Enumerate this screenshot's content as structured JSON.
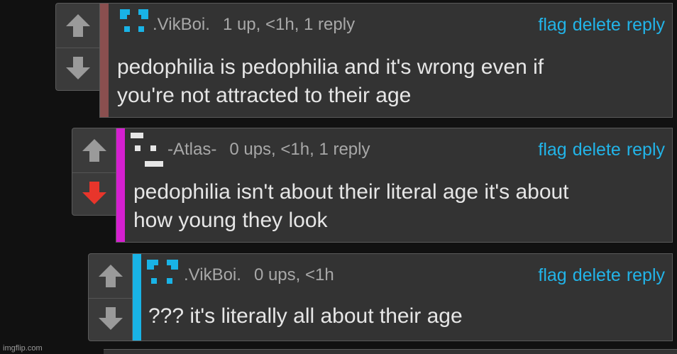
{
  "colors": {
    "background": "#111111",
    "card": "#333333",
    "link": "#22b4e8",
    "downvoted": "#e8352b",
    "arrow": "#9a9a9a",
    "stripe_1": "#8a4f4f",
    "stripe_2": "#d51fd0",
    "stripe_3": "#19b3e6"
  },
  "comments": [
    {
      "username": ".VikBoi.",
      "meta": "1 up, <1h, 1 reply",
      "actions": {
        "flag": "flag",
        "delete": "delete",
        "reply": "reply"
      },
      "text": "pedophilia is pedophilia and it's wrong even if\nyou're not attracted to their age",
      "upvote_icon": "up-arrow-icon",
      "downvote_icon": "down-arrow-icon",
      "downvoted": false
    },
    {
      "username": "-Atlas-",
      "meta": "0 ups, <1h, 1 reply",
      "actions": {
        "flag": "flag",
        "delete": "delete",
        "reply": "reply"
      },
      "text": "pedophilia isn't about their literal age it's about\nhow young they look",
      "upvote_icon": "up-arrow-icon",
      "downvote_icon": "down-arrow-icon",
      "downvoted": true
    },
    {
      "username": ".VikBoi.",
      "meta": "0 ups, <1h",
      "actions": {
        "flag": "flag",
        "delete": "delete",
        "reply": "reply"
      },
      "text": "??? it's literally all about their age",
      "upvote_icon": "up-arrow-icon",
      "downvote_icon": "down-arrow-icon",
      "downvoted": false
    }
  ],
  "watermark": "imgflip.com"
}
